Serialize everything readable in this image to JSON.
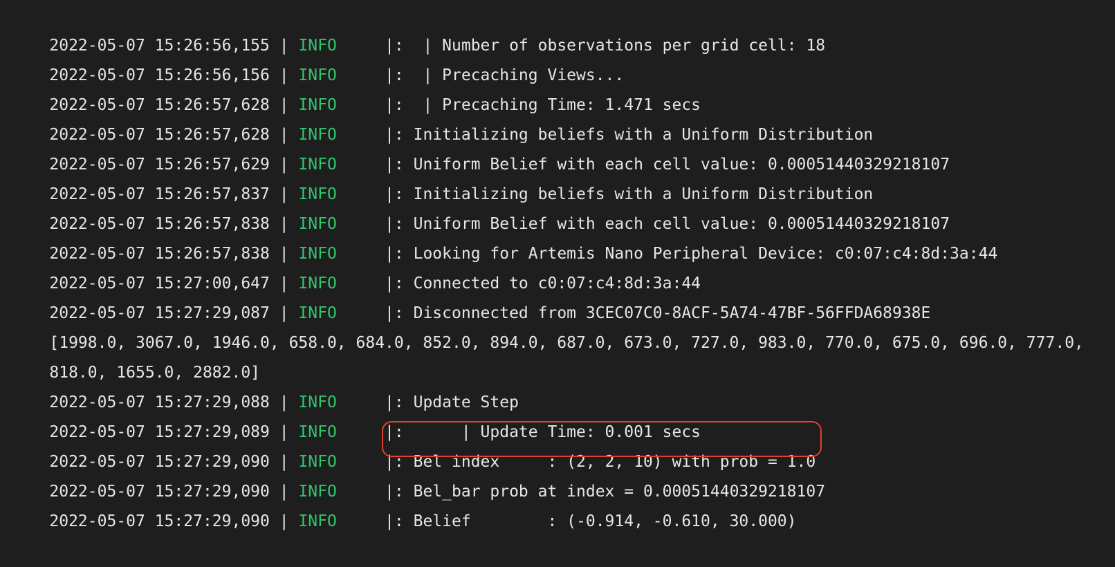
{
  "log": {
    "level_color": "#32c36c",
    "highlight_color": "#e0412d",
    "lines": [
      {
        "kind": "log",
        "timestamp": "2022-05-07 15:26:56,155",
        "sep1": " | ",
        "level": "INFO",
        "sep2": "     |: ",
        "message": " | Number of observations per grid cell: 18"
      },
      {
        "kind": "log",
        "timestamp": "2022-05-07 15:26:56,156",
        "sep1": " | ",
        "level": "INFO",
        "sep2": "     |: ",
        "message": " | Precaching Views..."
      },
      {
        "kind": "log",
        "timestamp": "2022-05-07 15:26:57,628",
        "sep1": " | ",
        "level": "INFO",
        "sep2": "     |: ",
        "message": " | Precaching Time: 1.471 secs"
      },
      {
        "kind": "log",
        "timestamp": "2022-05-07 15:26:57,628",
        "sep1": " | ",
        "level": "INFO",
        "sep2": "     |: ",
        "message": "Initializing beliefs with a Uniform Distribution"
      },
      {
        "kind": "log",
        "timestamp": "2022-05-07 15:26:57,629",
        "sep1": " | ",
        "level": "INFO",
        "sep2": "     |: ",
        "message": "Uniform Belief with each cell value: 0.00051440329218107"
      },
      {
        "kind": "log",
        "timestamp": "2022-05-07 15:26:57,837",
        "sep1": " | ",
        "level": "INFO",
        "sep2": "     |: ",
        "message": "Initializing beliefs with a Uniform Distribution"
      },
      {
        "kind": "log",
        "timestamp": "2022-05-07 15:26:57,838",
        "sep1": " | ",
        "level": "INFO",
        "sep2": "     |: ",
        "message": "Uniform Belief with each cell value: 0.00051440329218107"
      },
      {
        "kind": "log",
        "timestamp": "2022-05-07 15:26:57,838",
        "sep1": " | ",
        "level": "INFO",
        "sep2": "     |: ",
        "message": "Looking for Artemis Nano Peripheral Device: c0:07:c4:8d:3a:44"
      },
      {
        "kind": "log",
        "timestamp": "2022-05-07 15:27:00,647",
        "sep1": " | ",
        "level": "INFO",
        "sep2": "     |: ",
        "message": "Connected to c0:07:c4:8d:3a:44"
      },
      {
        "kind": "log",
        "timestamp": "2022-05-07 15:27:29,087",
        "sep1": " | ",
        "level": "INFO",
        "sep2": "     |: ",
        "message": "Disconnected from 3CEC07C0-8ACF-5A74-47BF-56FFDA68938E"
      },
      {
        "kind": "plain",
        "text": "[1998.0, 3067.0, 1946.0, 658.0, 684.0, 852.0, 894.0, 687.0, 673.0, 727.0, 983.0, 770.0, 675.0, 696.0, 777.0,"
      },
      {
        "kind": "plain",
        "text": "818.0, 1655.0, 2882.0]"
      },
      {
        "kind": "log",
        "timestamp": "2022-05-07 15:27:29,088",
        "sep1": " | ",
        "level": "INFO",
        "sep2": "     |: ",
        "message": "Update Step"
      },
      {
        "kind": "log",
        "timestamp": "2022-05-07 15:27:29,089",
        "sep1": " | ",
        "level": "INFO",
        "sep2": "     |: ",
        "message": "     | Update Time: 0.001 secs"
      },
      {
        "kind": "log",
        "timestamp": "2022-05-07 15:27:29,090",
        "sep1": " | ",
        "level": "INFO",
        "sep2": "     |: ",
        "message": "Bel index     : (2, 2, 10) with prob = 1.0",
        "highlighted": true
      },
      {
        "kind": "log",
        "timestamp": "2022-05-07 15:27:29,090",
        "sep1": " | ",
        "level": "INFO",
        "sep2": "     |: ",
        "message": "Bel_bar prob at index = 0.00051440329218107"
      },
      {
        "kind": "log",
        "timestamp": "2022-05-07 15:27:29,090",
        "sep1": " | ",
        "level": "INFO",
        "sep2": "     |: ",
        "message": "Belief        : (-0.914, -0.610, 30.000)"
      }
    ]
  }
}
